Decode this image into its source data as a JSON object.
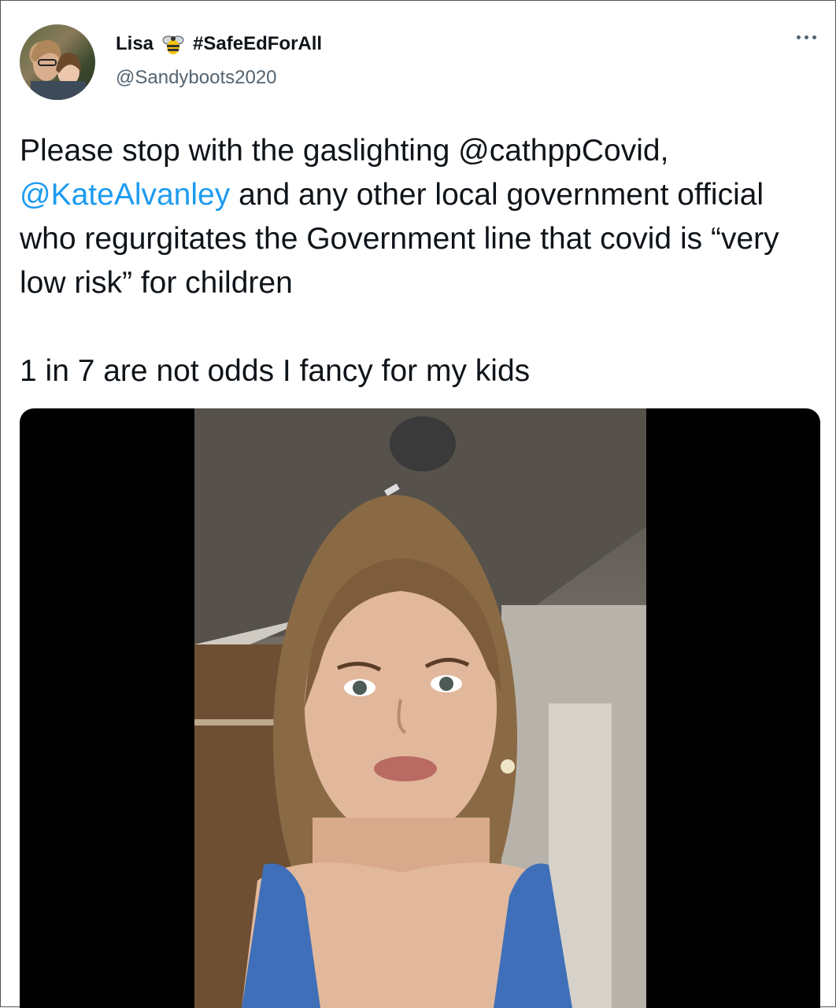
{
  "tweet": {
    "author_name": "Lisa",
    "author_tag": "#SafeEdForAll",
    "handle": "@Sandyboots2020",
    "text_parts": [
      "Please stop with the gaslighting @cathppCovid,\n",
      "@KateAlvanley",
      " and any other local government official who regurgitates the Government line that covid is “very low risk” for children\n\n1 in 7 are not odds I fancy for my kids"
    ]
  },
  "icons": {
    "name_emoji": "bee-icon",
    "more": "more-options-icon"
  },
  "colors": {
    "text": "#0f1419",
    "secondary": "#536471",
    "link": "#1d9bf0",
    "media_bg": "#000000"
  }
}
